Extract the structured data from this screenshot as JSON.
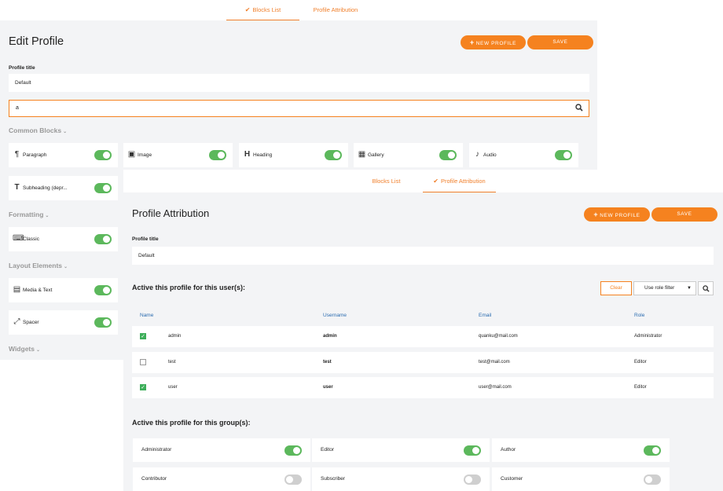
{
  "panel_a": {
    "tabs": [
      {
        "label": "Blocks List",
        "active": true
      },
      {
        "label": "Profile Attribution",
        "active": false
      }
    ],
    "check_glyph": "✔",
    "title": "Edit Profile",
    "new_profile_label": "NEW PROFILE",
    "save_label": "SAVE",
    "profile_title_label": "Profile title",
    "profile_title_value": "Default",
    "search_value": "a",
    "sections": [
      "Common Blocks",
      "Formatting",
      "Layout Elements",
      "Widgets"
    ],
    "blocks": [
      {
        "label": "Paragraph",
        "icon": "paragraph-icon",
        "glyph": "¶",
        "on": true
      },
      {
        "label": "Image",
        "icon": "image-icon",
        "glyph": "▣",
        "on": true
      },
      {
        "label": "Heading",
        "icon": "heading-icon",
        "glyph": "H",
        "on": true
      },
      {
        "label": "Gallery",
        "icon": "gallery-icon",
        "glyph": "▦",
        "on": true
      },
      {
        "label": "Audio",
        "icon": "audio-icon",
        "glyph": "♪",
        "on": true
      },
      {
        "label": "Subheading (depr...",
        "icon": "subheading-icon",
        "glyph": "T",
        "on": true
      },
      {
        "label": "Classic",
        "icon": "keyboard-icon",
        "glyph": "⌨",
        "on": true
      },
      {
        "label": "Media & Text",
        "icon": "media-text-icon",
        "glyph": "▤",
        "on": true
      },
      {
        "label": "Spacer",
        "icon": "spacer-icon",
        "glyph": "⤢",
        "on": true
      }
    ]
  },
  "panel_b": {
    "tabs": [
      {
        "label": "Blocks List",
        "active": false
      },
      {
        "label": "Profile Attribution",
        "active": true
      }
    ],
    "title": "Profile Attribution",
    "new_profile_label": "NEW PROFILE",
    "save_label": "SAVE",
    "profile_title_label": "Profile title",
    "profile_title_value": "Default",
    "users_heading": "Active this profile for this user(s):",
    "clear_label": "Clear",
    "role_filter": "Use role filter",
    "columns": [
      "Name",
      "Username",
      "Email",
      "Role"
    ],
    "users": [
      {
        "checked": true,
        "name": "admin",
        "username": "admin",
        "email": "quanku@mail.com",
        "role": "Administrator"
      },
      {
        "checked": false,
        "name": "test",
        "username": "test",
        "email": "test@mail.com",
        "role": "Editor"
      },
      {
        "checked": true,
        "name": "user",
        "username": "user",
        "email": "user@mail.com",
        "role": "Editor"
      }
    ],
    "groups_heading": "Active this profile for this group(s):",
    "groups": [
      {
        "label": "Administrator",
        "on": true
      },
      {
        "label": "Editor",
        "on": true
      },
      {
        "label": "Author",
        "on": true
      },
      {
        "label": "Contributor",
        "on": false
      },
      {
        "label": "Subscriber",
        "on": false
      },
      {
        "label": "Customer",
        "on": false
      }
    ]
  },
  "colors": {
    "accent": "#f5821f",
    "toggle_on": "#5cb85c",
    "toggle_off": "#cfcfcf",
    "link": "#2b6cb0"
  }
}
